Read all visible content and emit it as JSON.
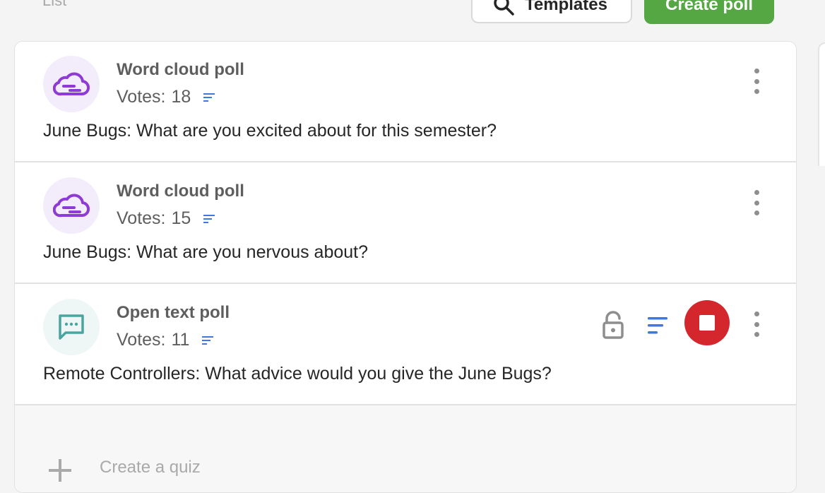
{
  "header": {
    "list_label": "List",
    "templates_label": "Templates",
    "create_poll_label": "Create poll"
  },
  "polls": [
    {
      "type": "Word cloud poll",
      "icon": "cloud-icon",
      "votes_label": "Votes:",
      "votes": "18",
      "question": "June Bugs: What are you excited about for this semester?",
      "active": false
    },
    {
      "type": "Word cloud poll",
      "icon": "cloud-icon",
      "votes_label": "Votes:",
      "votes": "15",
      "question": "June Bugs: What are you nervous about?",
      "active": false
    },
    {
      "type": "Open text poll",
      "icon": "chat-bubble-icon",
      "votes_label": "Votes:",
      "votes": "11",
      "question": "Remote Controllers: What advice would you give the June Bugs?",
      "active": true
    }
  ],
  "footer": {
    "create_quiz_label": "Create a quiz"
  },
  "colors": {
    "primary_green": "#55a744",
    "stop_red": "#d3262d",
    "word_cloud_purple": "#8e3bd6",
    "open_text_teal": "#4aa5a0",
    "results_blue": "#3d7ae0"
  }
}
